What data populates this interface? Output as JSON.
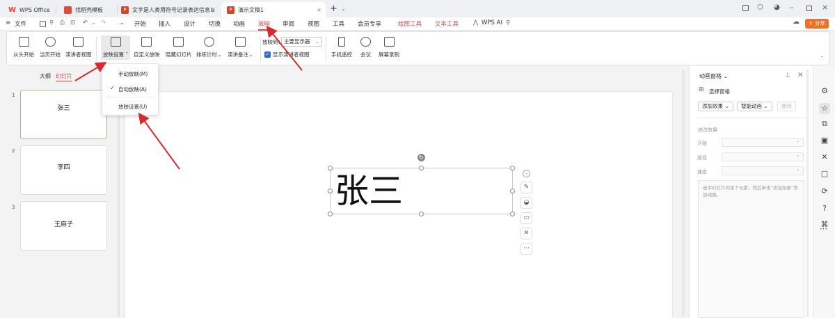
{
  "title_bar": {
    "tabs": [
      {
        "label": "WPS Office",
        "icon": "wps-logo-icon"
      },
      {
        "label": "找稻壳模板",
        "icon": "docer-icon"
      },
      {
        "label": "文字是人类用符号记录表达信息以",
        "icon": "presentation-file-icon"
      },
      {
        "label": "演示文稿1",
        "icon": "presentation-file-icon"
      }
    ],
    "new_tab_icon": "plus-icon"
  },
  "menu": {
    "file_label": "文件",
    "items": [
      "开始",
      "插入",
      "设计",
      "切换",
      "动画",
      "放映",
      "审阅",
      "视图",
      "工具",
      "会员专享",
      "绘图工具",
      "文本工具",
      "WPS AI"
    ],
    "active": "放映",
    "share_label": "分享"
  },
  "ribbon": {
    "buttons": [
      "从头开始",
      "当页开始",
      "演讲者视图",
      "放映设置",
      "自定义放映",
      "隐藏幻灯片",
      "排练计时",
      "演讲备注",
      "手机遥控",
      "会议",
      "屏幕录制"
    ],
    "display_label": "放映到：",
    "display_value": "主要显示器",
    "presenter_checkbox_label": "显示演讲者视图"
  },
  "slide_settings_menu": {
    "items": [
      "手动放映(M)",
      "自动放映(A)",
      "放映设置(U)"
    ],
    "checked_index": 1
  },
  "left_pane": {
    "tabs": [
      "大纲",
      "幻灯片"
    ],
    "active_tab": "幻灯片",
    "slides": [
      {
        "number": "1",
        "text": "张三"
      },
      {
        "number": "2",
        "text": "李四"
      },
      {
        "number": "3",
        "text": "王麻子"
      }
    ]
  },
  "canvas": {
    "textbox_text": "张三"
  },
  "animation_pane": {
    "title": "动画窗格",
    "select_pane_label": "选择窗格",
    "add_effect_label": "添加效果",
    "smart_animation_label": "智能动画",
    "delete_label": "删除",
    "modify_effect_label": "修改效果",
    "start_label": "开始",
    "property_label": "属性",
    "speed_label": "速度",
    "hint_text": "选中幻灯片的某个元素，然后单击“添加效果”添加动画。"
  },
  "colors": {
    "accent": "#c0504d",
    "wps_red": "#e24b3c",
    "share_orange": "#f36f21",
    "arrow_red": "#d62b2b"
  }
}
